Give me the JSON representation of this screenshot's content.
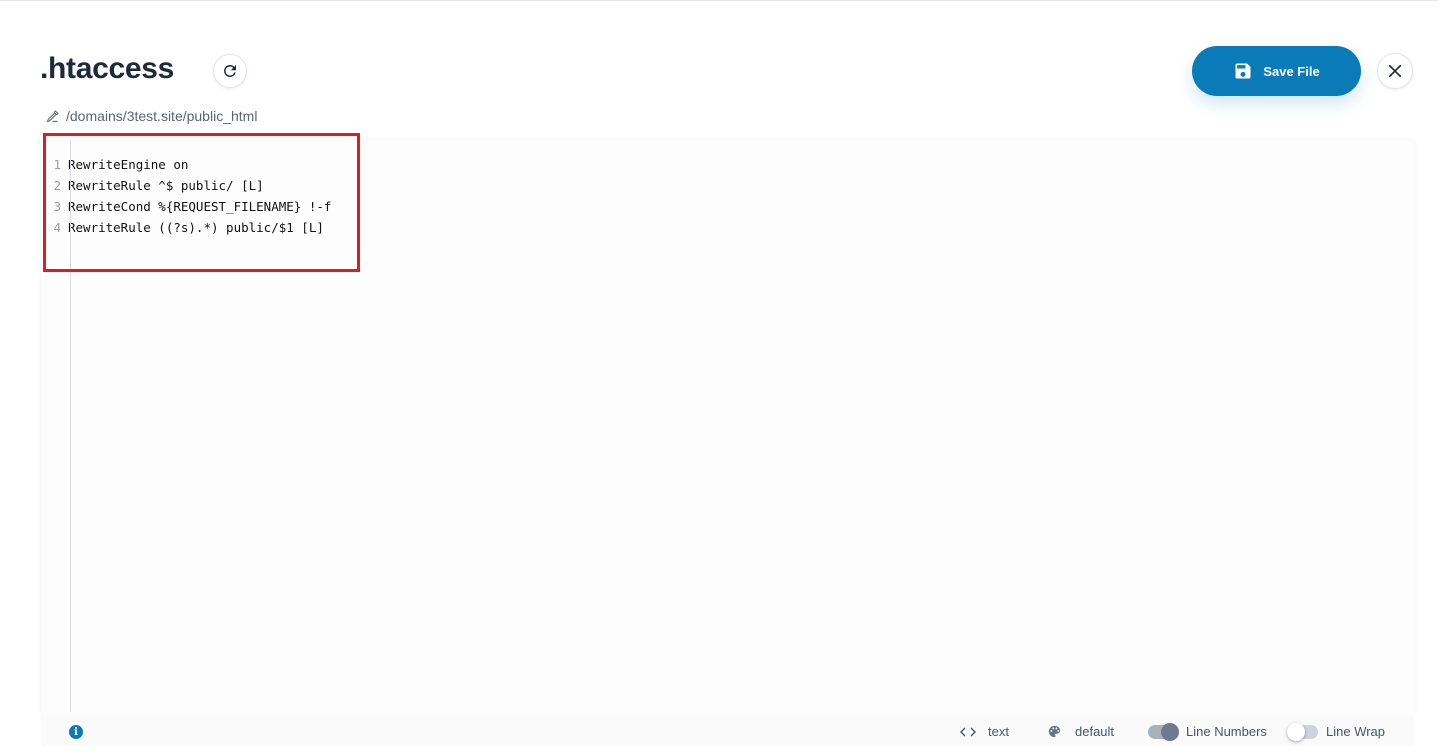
{
  "header": {
    "title": ".htaccess",
    "path": "/domains/3test.site/public_html",
    "save_label": "Save File"
  },
  "editor": {
    "lines": [
      {
        "number": "1",
        "text": "RewriteEngine on"
      },
      {
        "number": "2",
        "text": "RewriteRule ^$ public/ [L]"
      },
      {
        "number": "3",
        "text": "RewriteCond %{REQUEST_FILENAME} !-f"
      },
      {
        "number": "4",
        "text": "RewriteRule ((?s).*) public/$1 [L]"
      }
    ]
  },
  "status": {
    "mode": "text",
    "theme": "default",
    "line_numbers_label": "Line Numbers",
    "line_numbers_on": true,
    "line_wrap_label": "Line Wrap",
    "line_wrap_on": false
  },
  "icons": {
    "refresh": "refresh-icon",
    "close": "close-icon",
    "save": "floppy-disk-icon",
    "path": "pencil-icon",
    "info": "info-icon",
    "mode": "code-brackets-icon",
    "theme": "palette-icon"
  },
  "colors": {
    "accent": "#0a7ab8",
    "highlight": "#e11b22"
  }
}
